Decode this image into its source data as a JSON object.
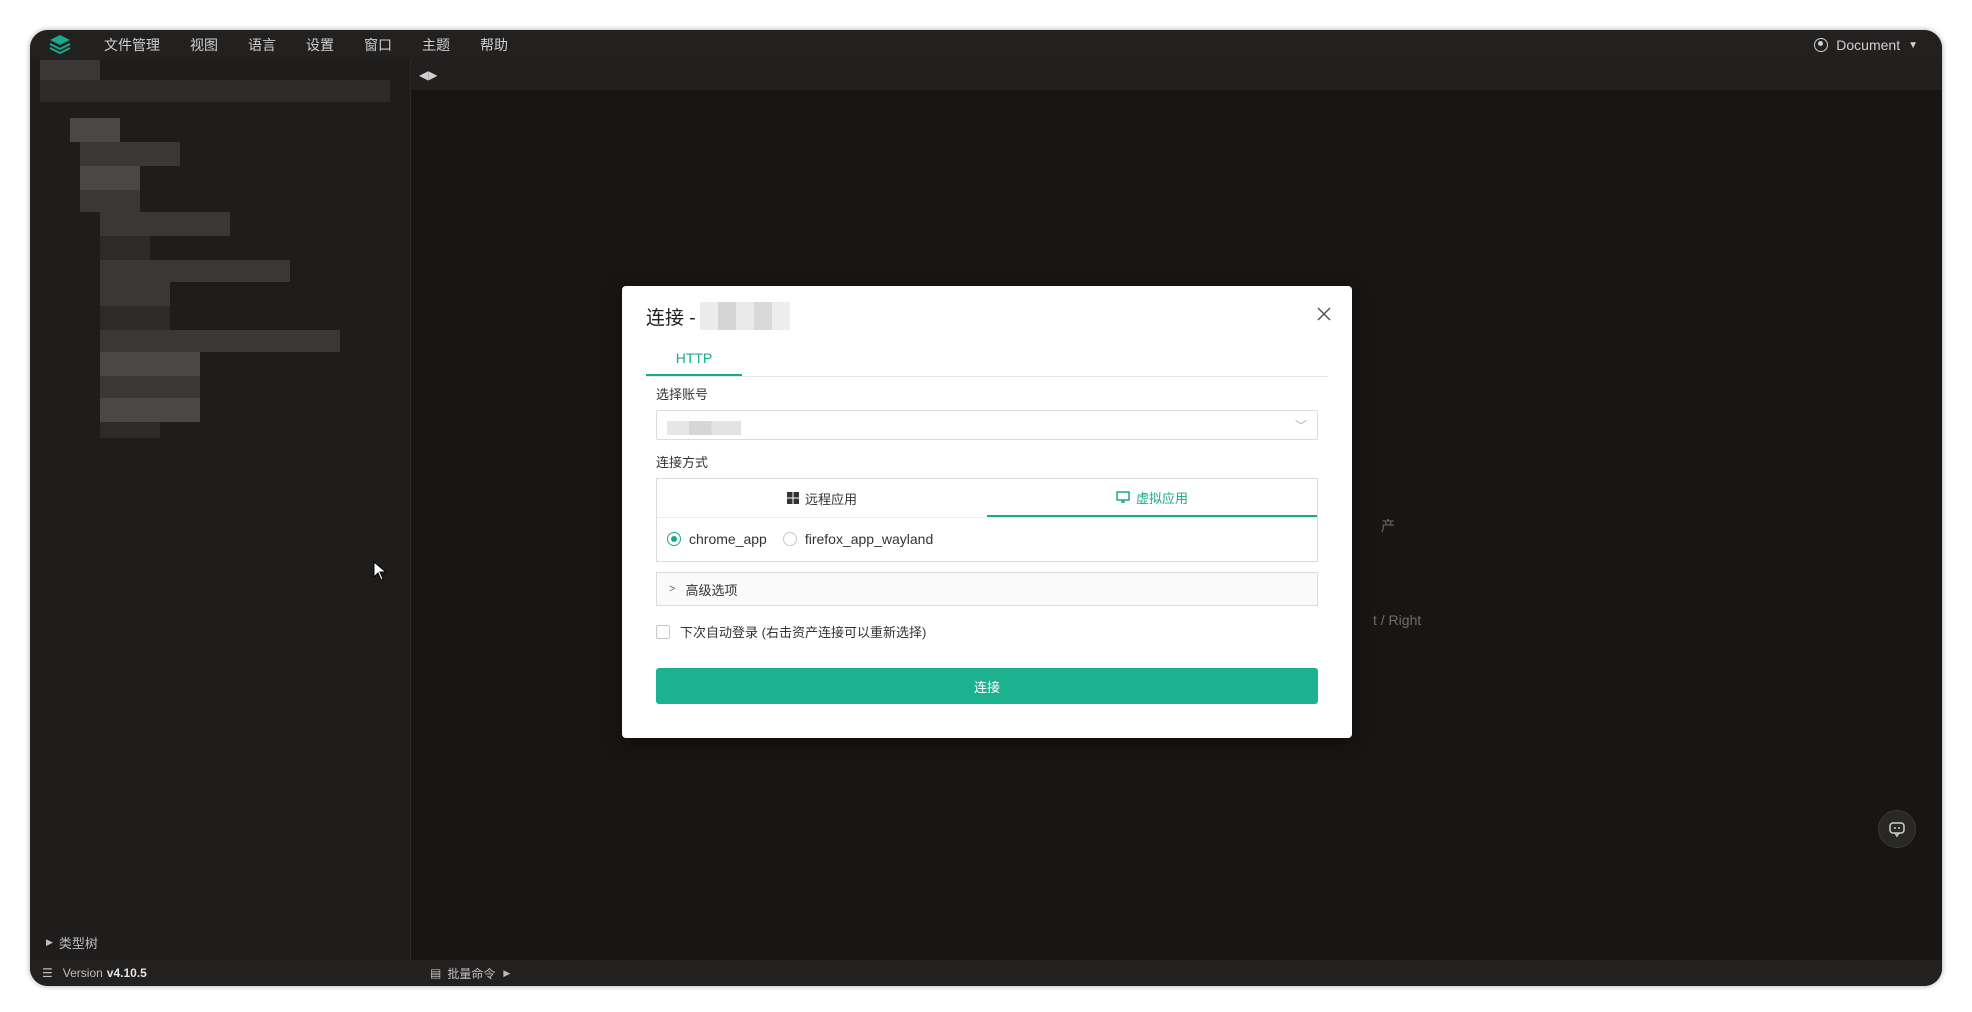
{
  "menubar": {
    "items": [
      "文件管理",
      "视图",
      "语言",
      "设置",
      "窗口",
      "主题",
      "帮助"
    ],
    "user_label": "Document"
  },
  "sidebar": {
    "type_tree_label": "类型树"
  },
  "statusbar": {
    "version_prefix": "Version",
    "version_number": "v4.10.5",
    "batch_command_label": "批量命令"
  },
  "main": {
    "hint_fragment_1": "t / Right",
    "hint_fragment_2": "产"
  },
  "dialog": {
    "title": "连接 -",
    "protocol_tab": "HTTP",
    "account_label": "选择账号",
    "connect_method_label": "连接方式",
    "method_tabs": [
      "远程应用",
      "虚拟应用"
    ],
    "active_method_index": 1,
    "apps": [
      "chrome_app",
      "firefox_app_wayland"
    ],
    "selected_app": "chrome_app",
    "advanced_label": "高级选项",
    "auto_login_label": "下次自动登录 (右击资产连接可以重新选择)",
    "connect_button": "连接"
  },
  "colors": {
    "accent": "#1aa98d",
    "button": "#1db28f",
    "window_bg": "#1c1a19"
  }
}
